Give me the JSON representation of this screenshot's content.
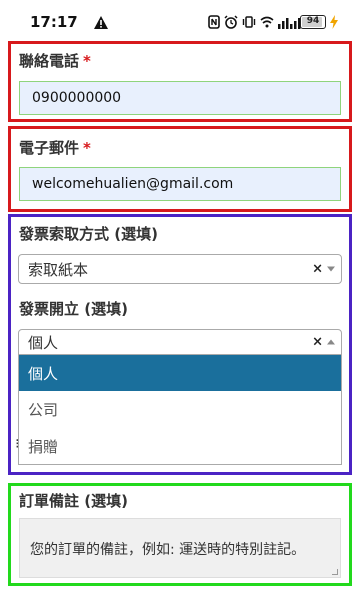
{
  "status_bar": {
    "time": "17:17",
    "battery": "94",
    "battery_level": 0.94
  },
  "form": {
    "phone": {
      "label": "聯絡電話",
      "required_mark": "*",
      "value": "0900000000"
    },
    "email": {
      "label": "電子郵件",
      "required_mark": "*",
      "value": "welcomehualien@gmail.com"
    },
    "invoice_retrieval": {
      "label": "發票索取方式 (選填)",
      "selected": "索取紙本",
      "clear": "×"
    },
    "invoice_issuance": {
      "label": "發票開立 (選填)",
      "selected": "個人",
      "clear": "×",
      "options": [
        "個人",
        "公司",
        "捐贈"
      ]
    },
    "hidden_label_fragment": "≡",
    "order_notes": {
      "label": "訂單備註 (選填)",
      "placeholder": "您的訂單的備註，例如: 運送時的特別註記。"
    }
  },
  "colors": {
    "highlight_red": "#d7191c",
    "highlight_purple": "#4b23c4",
    "highlight_green": "#22d91c",
    "option_active": "#1a6f9c",
    "autofill_bg": "#e8f0fd"
  }
}
